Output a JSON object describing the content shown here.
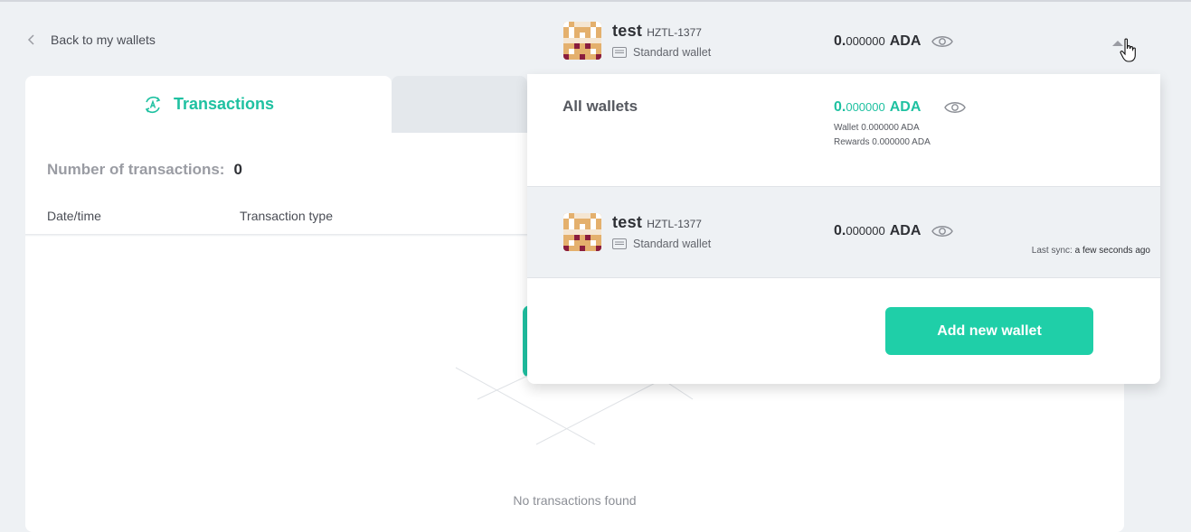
{
  "header": {
    "back_label": "Back to my wallets",
    "wallet": {
      "name": "test",
      "plate": "HZTL-1377",
      "type": "Standard wallet",
      "balance_int": "0.",
      "balance_dec": "000000",
      "currency": "ADA"
    }
  },
  "tabs": {
    "active_label": "Transactions"
  },
  "transactions": {
    "count_label": "Number of transactions:",
    "count": "0",
    "columns": [
      "Date/time",
      "Transaction type"
    ],
    "empty_message": "No transactions found"
  },
  "dropdown": {
    "all_wallets": {
      "title": "All wallets",
      "balance_int": "0.",
      "balance_dec": "000000",
      "currency": "ADA",
      "wallet_line": "Wallet 0.000000 ADA",
      "rewards_line": "Rewards 0.000000 ADA"
    },
    "wallet_row": {
      "name": "test",
      "plate": "HZTL-1377",
      "type": "Standard wallet",
      "balance_int": "0.",
      "balance_dec": "000000",
      "currency": "ADA",
      "last_sync_label": "Last sync:",
      "last_sync_value": "a few seconds ago"
    },
    "add_button": "Add new wallet"
  },
  "colors": {
    "accent": "#1fc1a1",
    "button": "#1fcfa8",
    "background": "#eef1f4"
  },
  "icons": [
    "chevron-left-icon",
    "wallet-avatar-icon",
    "wallet-type-icon",
    "eye-icon",
    "caret-up-icon",
    "transactions-icon",
    "cursor-hand-icon"
  ]
}
